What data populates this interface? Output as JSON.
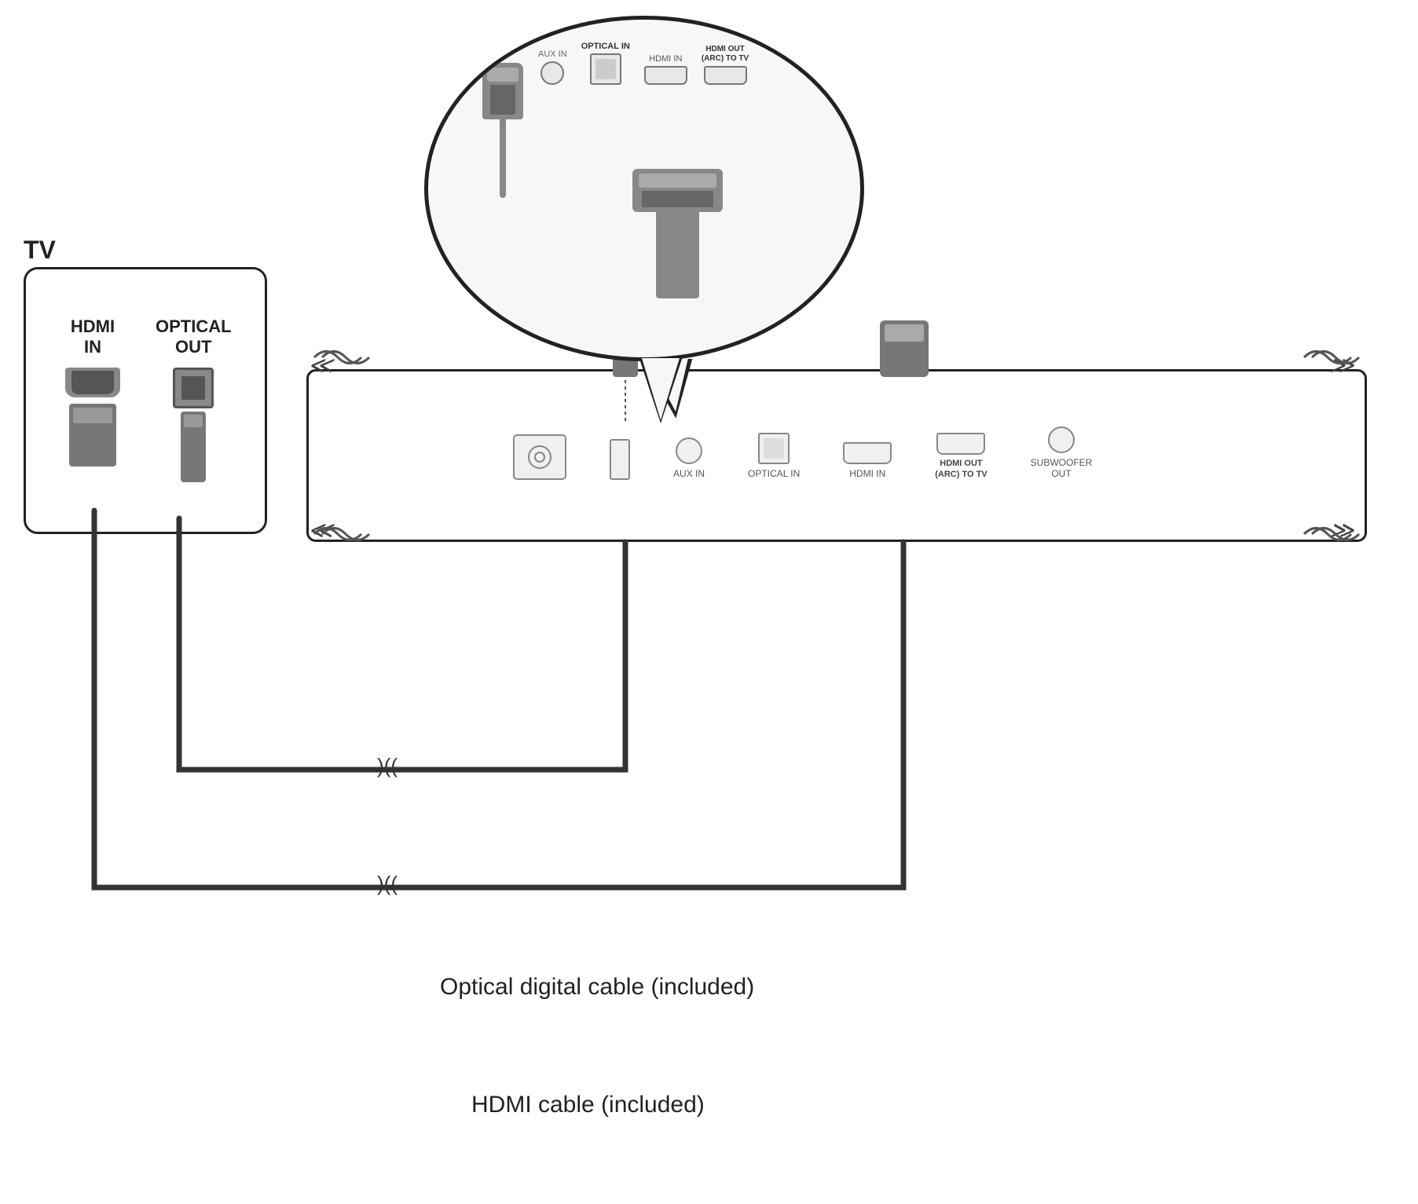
{
  "tv": {
    "label": "TV",
    "ports": {
      "hdmi_in": {
        "label": "HDMI\nIN"
      },
      "optical_out": {
        "label": "OPTICAL\nOUT"
      }
    }
  },
  "soundbar": {
    "ports": {
      "power": {
        "label": ""
      },
      "usb": {
        "label": ""
      },
      "aux_in": {
        "label": "AUX IN"
      },
      "optical_in": {
        "label": "OPTICAL IN"
      },
      "hdmi_in": {
        "label": "HDMI IN"
      },
      "hdmi_out": {
        "label": "HDMI OUT\n(ARC) TO TV"
      },
      "subwoofer_out": {
        "label": "SUBWOOFER\nOUT"
      }
    }
  },
  "zoom": {
    "ports": {
      "aux_in": {
        "label": "AUX IN"
      },
      "optical_in": {
        "label": "OPTICAL IN"
      },
      "hdmi_in": {
        "label": "HDMI IN"
      },
      "hdmi_out": {
        "label": "HDMI OUT\n(ARC) TO TV"
      }
    }
  },
  "cables": {
    "optical": {
      "label": "Optical digital cable (included)"
    },
    "hdmi": {
      "label": "HDMI cable (included)"
    }
  },
  "squiggles": {
    "top_left": "≪",
    "top_right": "≫",
    "bottom_left": "≪",
    "bottom_right": "≫",
    "optical_break": ")((",
    "hdmi_break": ")((  "
  }
}
